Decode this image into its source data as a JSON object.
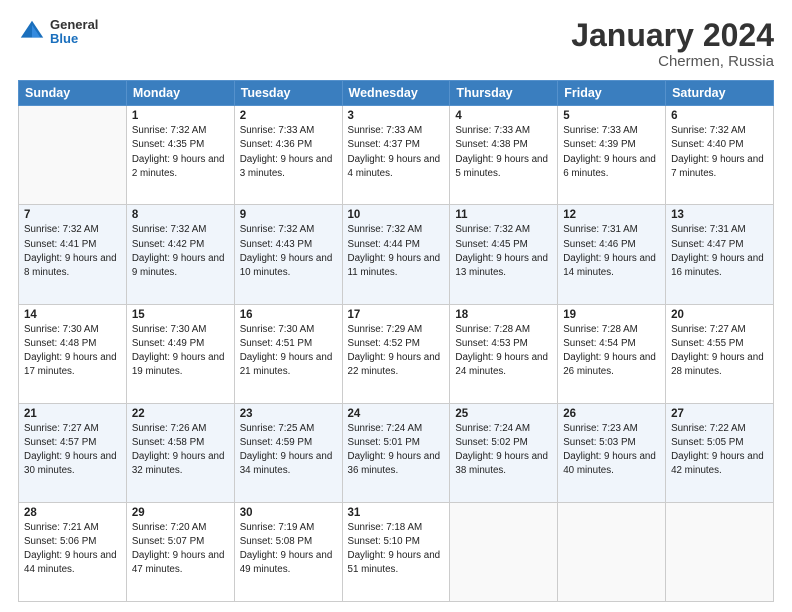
{
  "header": {
    "logo_general": "General",
    "logo_blue": "Blue",
    "month_title": "January 2024",
    "subtitle": "Chermen, Russia"
  },
  "days_of_week": [
    "Sunday",
    "Monday",
    "Tuesday",
    "Wednesday",
    "Thursday",
    "Friday",
    "Saturday"
  ],
  "weeks": [
    [
      {
        "day": "",
        "sunrise": "",
        "sunset": "",
        "daylight": ""
      },
      {
        "day": "1",
        "sunrise": "Sunrise: 7:32 AM",
        "sunset": "Sunset: 4:35 PM",
        "daylight": "Daylight: 9 hours and 2 minutes."
      },
      {
        "day": "2",
        "sunrise": "Sunrise: 7:33 AM",
        "sunset": "Sunset: 4:36 PM",
        "daylight": "Daylight: 9 hours and 3 minutes."
      },
      {
        "day": "3",
        "sunrise": "Sunrise: 7:33 AM",
        "sunset": "Sunset: 4:37 PM",
        "daylight": "Daylight: 9 hours and 4 minutes."
      },
      {
        "day": "4",
        "sunrise": "Sunrise: 7:33 AM",
        "sunset": "Sunset: 4:38 PM",
        "daylight": "Daylight: 9 hours and 5 minutes."
      },
      {
        "day": "5",
        "sunrise": "Sunrise: 7:33 AM",
        "sunset": "Sunset: 4:39 PM",
        "daylight": "Daylight: 9 hours and 6 minutes."
      },
      {
        "day": "6",
        "sunrise": "Sunrise: 7:32 AM",
        "sunset": "Sunset: 4:40 PM",
        "daylight": "Daylight: 9 hours and 7 minutes."
      }
    ],
    [
      {
        "day": "7",
        "sunrise": "Sunrise: 7:32 AM",
        "sunset": "Sunset: 4:41 PM",
        "daylight": "Daylight: 9 hours and 8 minutes."
      },
      {
        "day": "8",
        "sunrise": "Sunrise: 7:32 AM",
        "sunset": "Sunset: 4:42 PM",
        "daylight": "Daylight: 9 hours and 9 minutes."
      },
      {
        "day": "9",
        "sunrise": "Sunrise: 7:32 AM",
        "sunset": "Sunset: 4:43 PM",
        "daylight": "Daylight: 9 hours and 10 minutes."
      },
      {
        "day": "10",
        "sunrise": "Sunrise: 7:32 AM",
        "sunset": "Sunset: 4:44 PM",
        "daylight": "Daylight: 9 hours and 11 minutes."
      },
      {
        "day": "11",
        "sunrise": "Sunrise: 7:32 AM",
        "sunset": "Sunset: 4:45 PM",
        "daylight": "Daylight: 9 hours and 13 minutes."
      },
      {
        "day": "12",
        "sunrise": "Sunrise: 7:31 AM",
        "sunset": "Sunset: 4:46 PM",
        "daylight": "Daylight: 9 hours and 14 minutes."
      },
      {
        "day": "13",
        "sunrise": "Sunrise: 7:31 AM",
        "sunset": "Sunset: 4:47 PM",
        "daylight": "Daylight: 9 hours and 16 minutes."
      }
    ],
    [
      {
        "day": "14",
        "sunrise": "Sunrise: 7:30 AM",
        "sunset": "Sunset: 4:48 PM",
        "daylight": "Daylight: 9 hours and 17 minutes."
      },
      {
        "day": "15",
        "sunrise": "Sunrise: 7:30 AM",
        "sunset": "Sunset: 4:49 PM",
        "daylight": "Daylight: 9 hours and 19 minutes."
      },
      {
        "day": "16",
        "sunrise": "Sunrise: 7:30 AM",
        "sunset": "Sunset: 4:51 PM",
        "daylight": "Daylight: 9 hours and 21 minutes."
      },
      {
        "day": "17",
        "sunrise": "Sunrise: 7:29 AM",
        "sunset": "Sunset: 4:52 PM",
        "daylight": "Daylight: 9 hours and 22 minutes."
      },
      {
        "day": "18",
        "sunrise": "Sunrise: 7:28 AM",
        "sunset": "Sunset: 4:53 PM",
        "daylight": "Daylight: 9 hours and 24 minutes."
      },
      {
        "day": "19",
        "sunrise": "Sunrise: 7:28 AM",
        "sunset": "Sunset: 4:54 PM",
        "daylight": "Daylight: 9 hours and 26 minutes."
      },
      {
        "day": "20",
        "sunrise": "Sunrise: 7:27 AM",
        "sunset": "Sunset: 4:55 PM",
        "daylight": "Daylight: 9 hours and 28 minutes."
      }
    ],
    [
      {
        "day": "21",
        "sunrise": "Sunrise: 7:27 AM",
        "sunset": "Sunset: 4:57 PM",
        "daylight": "Daylight: 9 hours and 30 minutes."
      },
      {
        "day": "22",
        "sunrise": "Sunrise: 7:26 AM",
        "sunset": "Sunset: 4:58 PM",
        "daylight": "Daylight: 9 hours and 32 minutes."
      },
      {
        "day": "23",
        "sunrise": "Sunrise: 7:25 AM",
        "sunset": "Sunset: 4:59 PM",
        "daylight": "Daylight: 9 hours and 34 minutes."
      },
      {
        "day": "24",
        "sunrise": "Sunrise: 7:24 AM",
        "sunset": "Sunset: 5:01 PM",
        "daylight": "Daylight: 9 hours and 36 minutes."
      },
      {
        "day": "25",
        "sunrise": "Sunrise: 7:24 AM",
        "sunset": "Sunset: 5:02 PM",
        "daylight": "Daylight: 9 hours and 38 minutes."
      },
      {
        "day": "26",
        "sunrise": "Sunrise: 7:23 AM",
        "sunset": "Sunset: 5:03 PM",
        "daylight": "Daylight: 9 hours and 40 minutes."
      },
      {
        "day": "27",
        "sunrise": "Sunrise: 7:22 AM",
        "sunset": "Sunset: 5:05 PM",
        "daylight": "Daylight: 9 hours and 42 minutes."
      }
    ],
    [
      {
        "day": "28",
        "sunrise": "Sunrise: 7:21 AM",
        "sunset": "Sunset: 5:06 PM",
        "daylight": "Daylight: 9 hours and 44 minutes."
      },
      {
        "day": "29",
        "sunrise": "Sunrise: 7:20 AM",
        "sunset": "Sunset: 5:07 PM",
        "daylight": "Daylight: 9 hours and 47 minutes."
      },
      {
        "day": "30",
        "sunrise": "Sunrise: 7:19 AM",
        "sunset": "Sunset: 5:08 PM",
        "daylight": "Daylight: 9 hours and 49 minutes."
      },
      {
        "day": "31",
        "sunrise": "Sunrise: 7:18 AM",
        "sunset": "Sunset: 5:10 PM",
        "daylight": "Daylight: 9 hours and 51 minutes."
      },
      {
        "day": "",
        "sunrise": "",
        "sunset": "",
        "daylight": ""
      },
      {
        "day": "",
        "sunrise": "",
        "sunset": "",
        "daylight": ""
      },
      {
        "day": "",
        "sunrise": "",
        "sunset": "",
        "daylight": ""
      }
    ]
  ]
}
